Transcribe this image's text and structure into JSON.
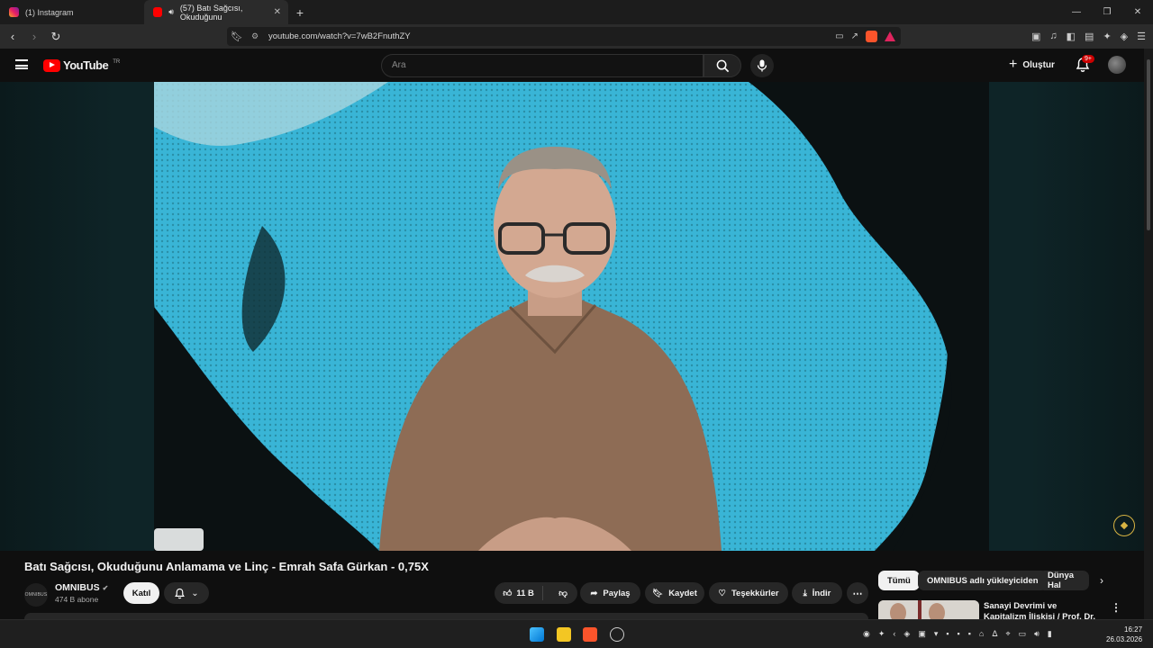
{
  "browser": {
    "tabs": [
      {
        "label": "(1) Instagram",
        "active": false,
        "icon": "instagram-icon"
      },
      {
        "label": "(57) Batı Sağcısı, Okuduğunu",
        "active": true,
        "icon": "youtube-icon"
      }
    ],
    "url": "youtube.com/watch?v=7wB2FnuthZY"
  },
  "youtube": {
    "logo_text": "YouTube",
    "country_code": "TR",
    "search_placeholder": "Ara",
    "create_label": "Oluştur",
    "notif_badge": "9+"
  },
  "video": {
    "title": "Batı Sağcısı, Okuduğunu Anlamama ve Linç - Emrah Safa Gürkan - 0,75X",
    "channel": {
      "name": "OMNIBUS",
      "avatar_text": "OMNIBUS",
      "subscribers": "474 B abone",
      "join_label": "Katıl"
    },
    "actions": {
      "likes": "11 B",
      "share": "Paylaş",
      "save": "Kaydet",
      "thanks": "Teşekkürler",
      "download": "İndir"
    }
  },
  "sidebar": {
    "chips": [
      "Tümü",
      "OMNIBUS adlı yükleyiciden",
      "Dünya Hal"
    ],
    "recommendation": {
      "title": "Sanayi Devrimi ve Kapitalizm İlişkisi / Prof. Dr. Emrah Safa"
    }
  },
  "taskbar": {
    "time": "16:27",
    "date": "26.03.2026"
  },
  "colors": {
    "youtube_red": "#ff0000",
    "brave_orange": "#fb542b",
    "background": "#0f0f0f"
  }
}
